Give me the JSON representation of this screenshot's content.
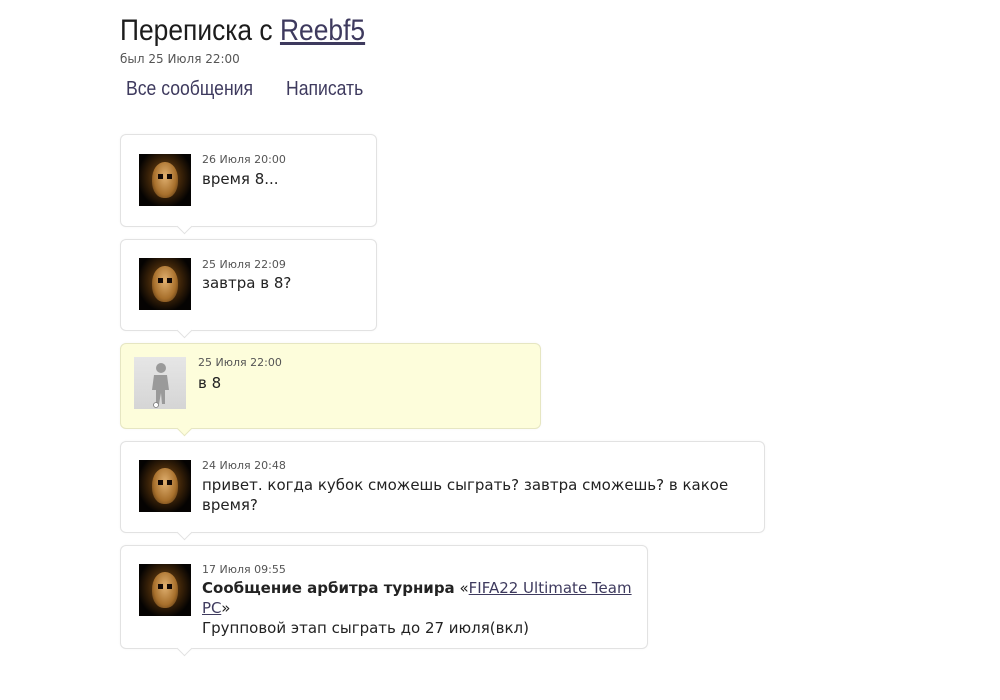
{
  "header": {
    "title_prefix": "Переписка с",
    "username": "Reebf5",
    "last_seen": "был 25 Июля 22:00"
  },
  "nav": {
    "all_messages": "Все сообщения",
    "write": "Написать"
  },
  "messages": [
    {
      "date": "26 Июля 20:00",
      "text": "время 8..."
    },
    {
      "date": "25 Июля 22:09",
      "text": "завтра в 8?"
    },
    {
      "date": "25 Июля 22:00",
      "text": "в 8"
    },
    {
      "date": "24 Июля 20:48",
      "text": "привет. когда кубок сможешь сыграть? завтра сможешь? в какое время?"
    },
    {
      "date": "17 Июля 09:55",
      "bold": "Сообщение арбитра турнира",
      "quote_open": " «",
      "link": "FIFA22 Ultimate Team PC",
      "quote_close": "»",
      "text": "Групповой этап сыграть до 27 июля(вкл)"
    }
  ]
}
